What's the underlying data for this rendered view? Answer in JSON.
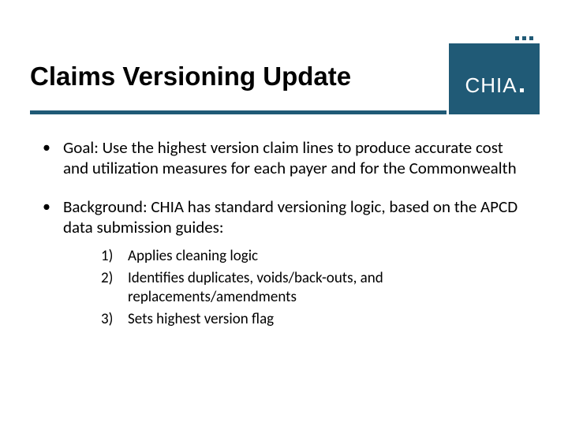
{
  "logo": {
    "text": "CHIA"
  },
  "title": "Claims Versioning Update",
  "bullets": [
    {
      "text": "Goal: Use the highest version claim lines to produce accurate cost and utilization measures for each payer and for the Commonwealth"
    },
    {
      "text": "Background: CHIA has standard versioning logic, based on the APCD data submission guides:",
      "numbered": [
        {
          "n": "1)",
          "text": "Applies cleaning logic"
        },
        {
          "n": "2)",
          "text": "Identifies duplicates, voids/back-outs, and replacements/amendments"
        },
        {
          "n": "3)",
          "text": "Sets highest version flag"
        }
      ]
    }
  ]
}
